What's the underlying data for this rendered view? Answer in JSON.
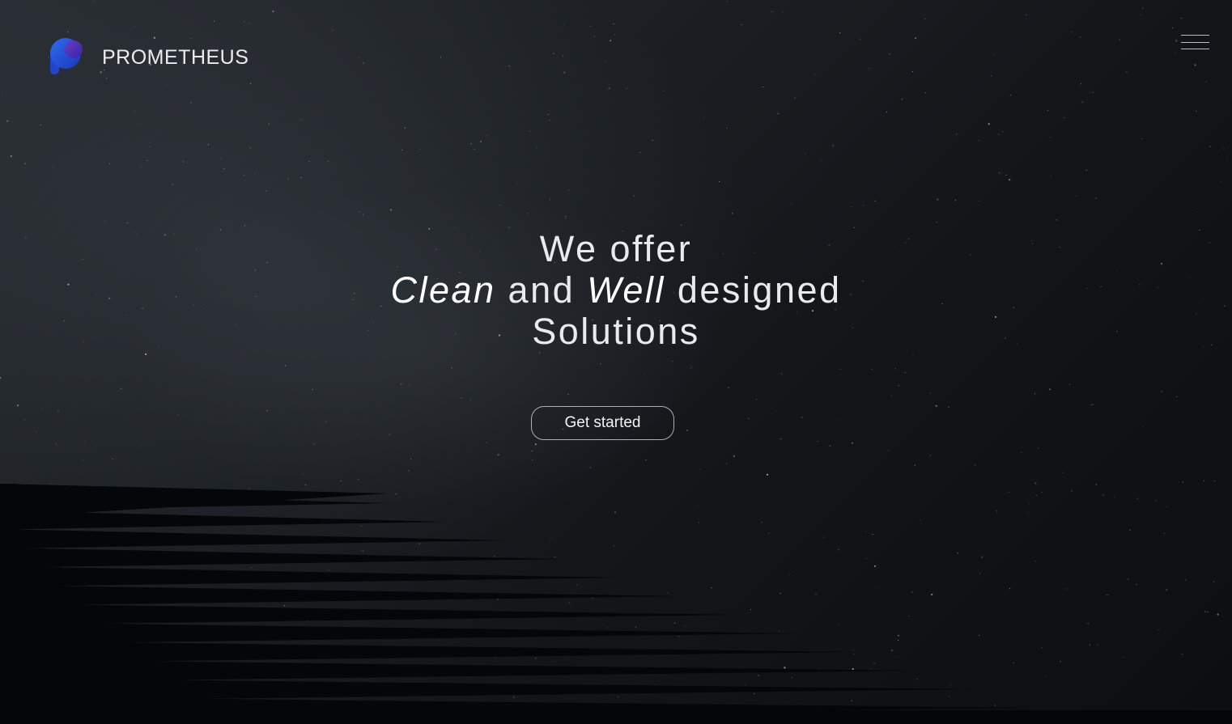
{
  "brand": {
    "name": "PROMETHEUS",
    "logo_icon": "prometheus-p-logo-icon",
    "logo_colors": [
      "#1b3fcf",
      "#3a6cf0",
      "#5a2fb0"
    ]
  },
  "nav": {
    "menu_icon": "hamburger-menu-icon"
  },
  "hero": {
    "line1": "We offer",
    "line2_part1": "Clean",
    "line2_part2": "and",
    "line2_part3": "Well",
    "line2_part4": "designed",
    "line3": "Solutions"
  },
  "cta": {
    "label": "Get started"
  },
  "colors": {
    "background": "#1b1f23",
    "text": "#e8ebee",
    "stripes": "#050607"
  }
}
